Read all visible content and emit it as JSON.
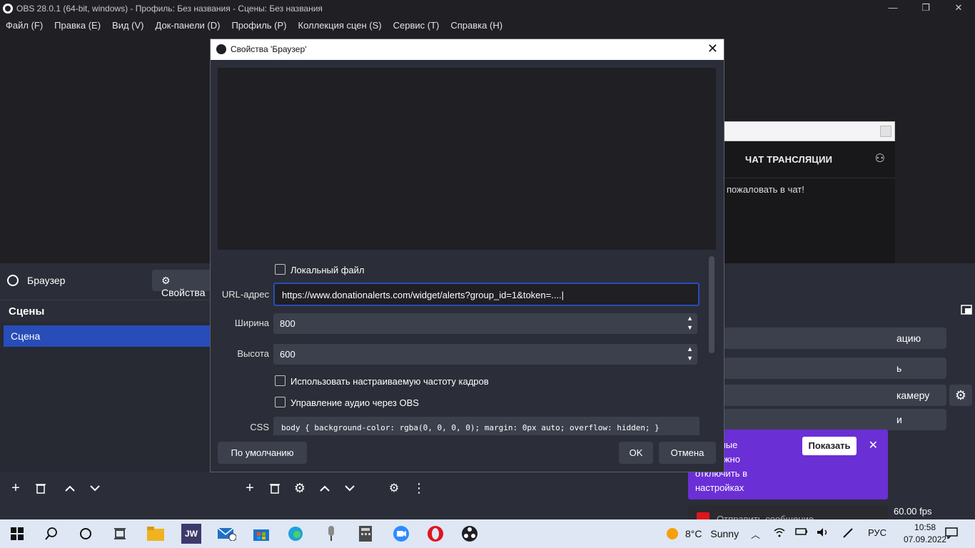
{
  "window": {
    "title": "OBS 28.0.1 (64-bit, windows) - Профиль: Без названия - Сцены: Без названия",
    "minimize": "—",
    "restore": "❐",
    "close": "✕"
  },
  "menu": [
    "Файл (F)",
    "Правка (E)",
    "Вид (V)",
    "Док-панели (D)",
    "Профиль (P)",
    "Коллекция сцен (S)",
    "Сервис (T)",
    "Справка (H)"
  ],
  "source_bar": {
    "source_name": "Браузер",
    "properties_button": "⚙ Свойства"
  },
  "scenes": {
    "title": "Сцены",
    "items": [
      "Сцена"
    ]
  },
  "dialog": {
    "title": "Свойства 'Браузер'",
    "close": "✕",
    "local_file_label": "Локальный файл",
    "url_label": "URL-адрес",
    "url_value": "https://www.donationalerts.com/widget/alerts?group_id=1&token=....|",
    "width_label": "Ширина",
    "width_value": "800",
    "height_label": "Высота",
    "height_value": "600",
    "custom_fps_label": "Использовать настраиваемую частоту кадров",
    "audio_label": "Управление аудио через OBS",
    "css_label": "CSS",
    "css_value": "body { background-color: rgba(0, 0, 0, 0); margin: 0px auto; overflow: hidden; }",
    "defaults_button": "По умолчанию",
    "ok_button": "OK",
    "cancel_button": "Отмена"
  },
  "chat": {
    "header": "ЧАТ ТРАНСЛЯЦИИ",
    "welcome": "пожаловать в чат!",
    "send_placeholder": "Отправить сообщение"
  },
  "controls": {
    "btn1": "ацию",
    "btn2": "ь",
    "btn3": "камеру",
    "btn4": "и"
  },
  "notification": {
    "text": "рованные\nики можно\nотключить в\nнастройках",
    "show_button": "Показать",
    "close": "✕"
  },
  "status": {
    "fps": "60.00 fps"
  },
  "taskbar": {
    "weather_temp": "8°C",
    "weather_text": "Sunny",
    "language": "РУС",
    "time": "10:58",
    "date": "07.09.2022",
    "jw_label": "JW"
  },
  "colors": {
    "accent_blue": "#284cb8",
    "twitch_purple": "#6b2fd6",
    "opera_red": "#e0141e"
  }
}
